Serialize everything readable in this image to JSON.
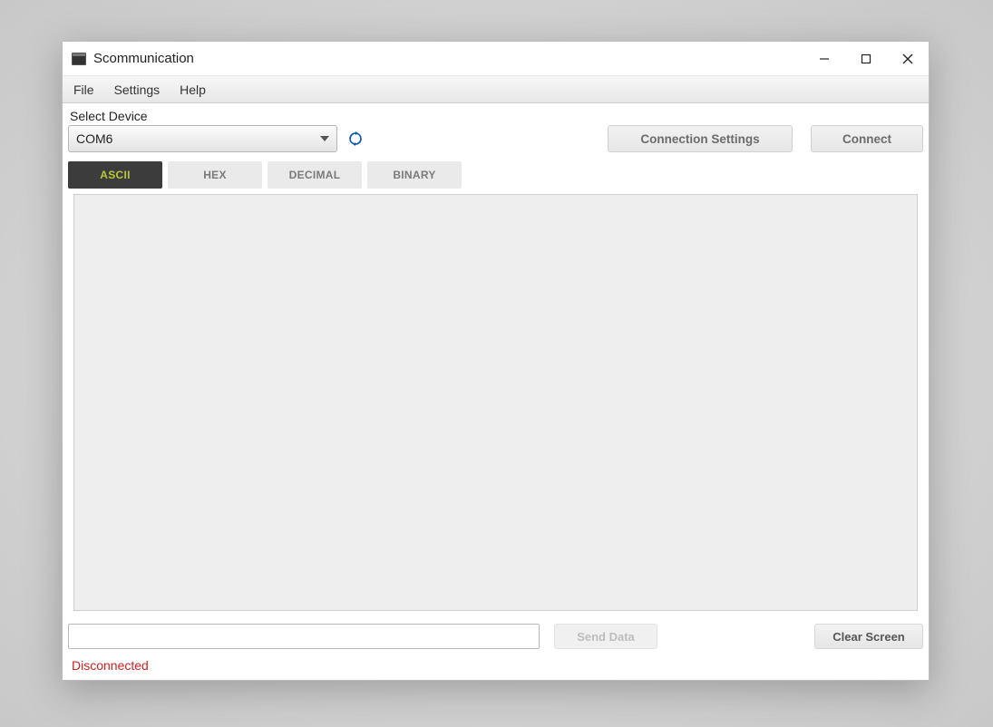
{
  "window": {
    "title": "Scommunication"
  },
  "menubar": {
    "items": [
      "File",
      "Settings",
      "Help"
    ]
  },
  "device": {
    "label": "Select Device",
    "selected": "COM6"
  },
  "buttons": {
    "connection_settings": "Connection Settings",
    "connect": "Connect",
    "send_data": "Send Data",
    "clear_screen": "Clear Screen"
  },
  "tabs": [
    {
      "label": "ASCII",
      "active": true
    },
    {
      "label": "HEX",
      "active": false
    },
    {
      "label": "DECIMAL",
      "active": false
    },
    {
      "label": "BINARY",
      "active": false
    }
  ],
  "input": {
    "value": ""
  },
  "status": {
    "text": "Disconnected",
    "color": "#d42020"
  }
}
